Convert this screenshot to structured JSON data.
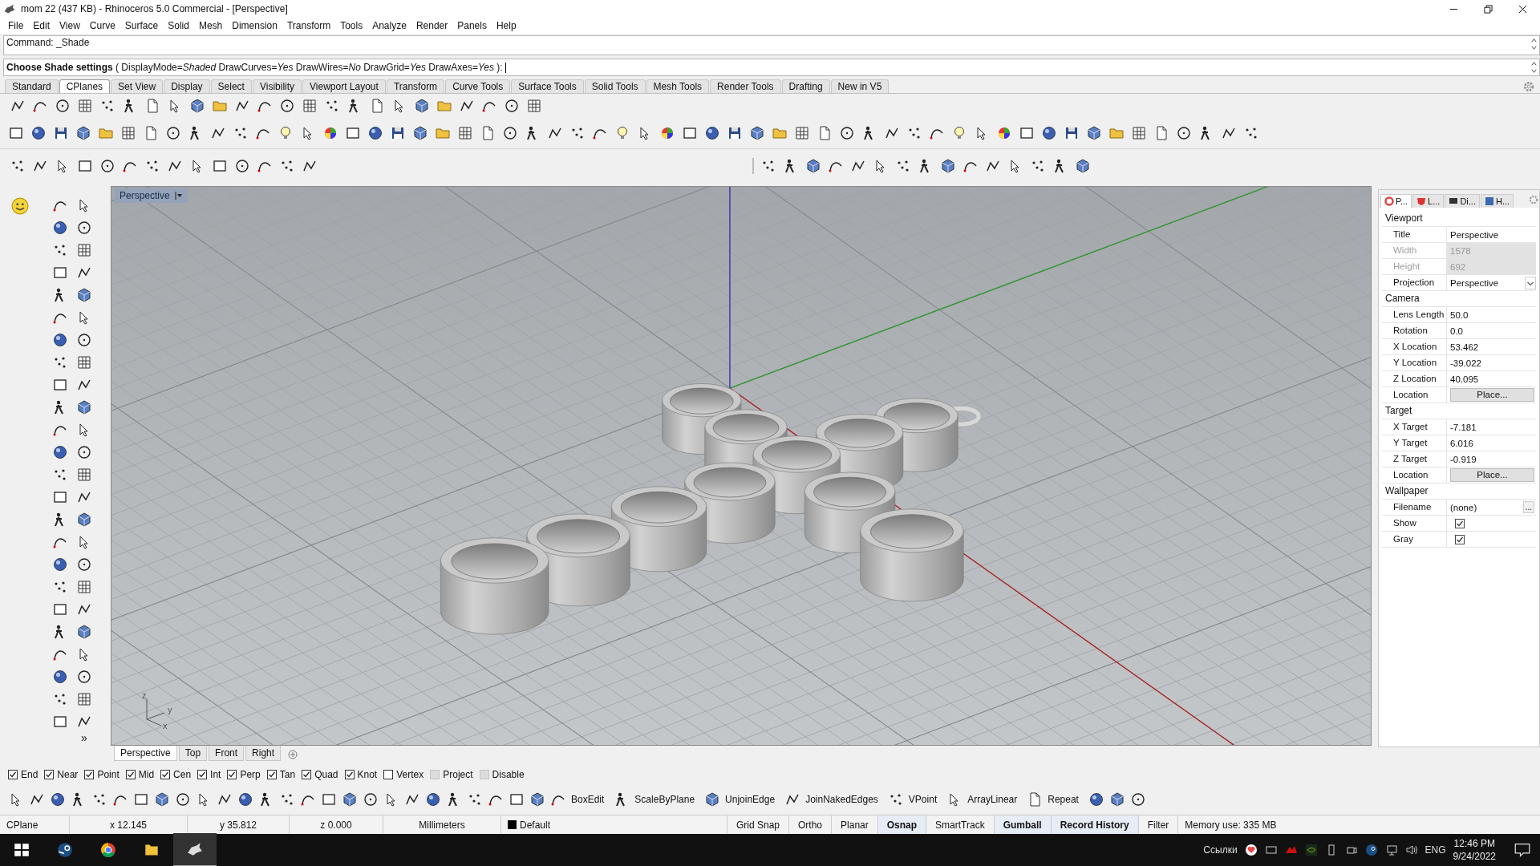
{
  "window": {
    "title": "mom 22 (437 KB) - Rhinoceros 5.0 Commercial - [Perspective]"
  },
  "menu": [
    "File",
    "Edit",
    "View",
    "Curve",
    "Surface",
    "Solid",
    "Mesh",
    "Dimension",
    "Transform",
    "Tools",
    "Analyze",
    "Render",
    "Panels",
    "Help"
  ],
  "command": {
    "history": "Command: _Shade",
    "prompt": "**Choose Shade settings** ( DisplayMode=*Shaded* DrawCurves=*Yes* DrawWires=*No* DrawGrid=*Yes* DrawAxes=*Yes* ):"
  },
  "toolbar_tabs": [
    {
      "label": "Standard",
      "selected": false
    },
    {
      "label": "CPlanes",
      "selected": true
    },
    {
      "label": "Set View",
      "selected": false
    },
    {
      "label": "Display",
      "selected": false
    },
    {
      "label": "Select",
      "selected": false
    },
    {
      "label": "Visibility",
      "selected": false
    },
    {
      "label": "Viewport Layout",
      "selected": false
    },
    {
      "label": "Transform",
      "selected": false
    },
    {
      "label": "Curve Tools",
      "selected": false
    },
    {
      "label": "Surface Tools",
      "selected": false
    },
    {
      "label": "Solid Tools",
      "selected": false
    },
    {
      "label": "Mesh Tools",
      "selected": false
    },
    {
      "label": "Render Tools",
      "selected": false
    },
    {
      "label": "Drafting",
      "selected": false
    },
    {
      "label": "New in V5",
      "selected": false
    }
  ],
  "left_toolbar_more": "»",
  "viewport": {
    "title": "Perspective",
    "axis_labels": [
      "z",
      "y",
      "x"
    ]
  },
  "viewport_tabs": [
    {
      "label": "Perspective",
      "selected": true
    },
    {
      "label": "Top",
      "selected": false
    },
    {
      "label": "Front",
      "selected": false
    },
    {
      "label": "Right",
      "selected": false
    }
  ],
  "panel": {
    "tabs": [
      {
        "label": "P...",
        "selected": true
      },
      {
        "label": "L...",
        "selected": false
      },
      {
        "label": "Di...",
        "selected": false
      },
      {
        "label": "H...",
        "selected": false
      }
    ],
    "sections": [
      {
        "title": "Viewport",
        "rows": [
          {
            "label": "Title",
            "value": "Perspective",
            "kind": "text"
          },
          {
            "label": "Width",
            "value": "1578",
            "kind": "readonly"
          },
          {
            "label": "Height",
            "value": "692",
            "kind": "readonly"
          },
          {
            "label": "Projection",
            "value": "Perspective",
            "kind": "dropdown"
          }
        ]
      },
      {
        "title": "Camera",
        "rows": [
          {
            "label": "Lens Length",
            "value": "50.0",
            "kind": "text"
          },
          {
            "label": "Rotation",
            "value": "0.0",
            "kind": "text"
          },
          {
            "label": "X Location",
            "value": "53.462",
            "kind": "text"
          },
          {
            "label": "Y Location",
            "value": "-39.022",
            "kind": "text"
          },
          {
            "label": "Z Location",
            "value": "40.095",
            "kind": "text"
          },
          {
            "label": "Location",
            "value": "Place...",
            "kind": "button"
          }
        ]
      },
      {
        "title": "Target",
        "rows": [
          {
            "label": "X Target",
            "value": "-7.181",
            "kind": "text"
          },
          {
            "label": "Y Target",
            "value": "6.016",
            "kind": "text"
          },
          {
            "label": "Z Target",
            "value": "-0.919",
            "kind": "text"
          },
          {
            "label": "Location",
            "value": "Place...",
            "kind": "button"
          }
        ]
      },
      {
        "title": "Wallpaper",
        "rows": [
          {
            "label": "Filename",
            "value": "(none)",
            "kind": "file",
            "button": "..."
          },
          {
            "label": "Show",
            "kind": "checkbox",
            "checked": true
          },
          {
            "label": "Gray",
            "kind": "checkbox",
            "checked": true
          }
        ]
      }
    ]
  },
  "osnaps": [
    {
      "label": "End",
      "checked": true,
      "disabled": false
    },
    {
      "label": "Near",
      "checked": true,
      "disabled": false
    },
    {
      "label": "Point",
      "checked": true,
      "disabled": false
    },
    {
      "label": "Mid",
      "checked": true,
      "disabled": false
    },
    {
      "label": "Cen",
      "checked": true,
      "disabled": false
    },
    {
      "label": "Int",
      "checked": true,
      "disabled": false
    },
    {
      "label": "Perp",
      "checked": true,
      "disabled": false
    },
    {
      "label": "Tan",
      "checked": true,
      "disabled": false
    },
    {
      "label": "Quad",
      "checked": true,
      "disabled": false
    },
    {
      "label": "Knot",
      "checked": true,
      "disabled": false
    },
    {
      "label": "Vertex",
      "checked": false,
      "disabled": false
    },
    {
      "label": "Project",
      "checked": false,
      "disabled": true
    },
    {
      "label": "Disable",
      "checked": false,
      "disabled": true
    }
  ],
  "command_buttons": [
    "BoxEdit",
    "ScaleByPlane",
    "UnjoinEdge",
    "JoinNakedEdges",
    "VPoint",
    "ArrayLinear",
    "Repeat"
  ],
  "status_bar": {
    "cplane": "CPlane",
    "x": "x 12.145",
    "y": "y 35.812",
    "z": "z 0.000",
    "units": "Millimeters",
    "layer": {
      "name": "Default",
      "color": "#000000"
    },
    "toggles": [
      {
        "label": "Grid Snap",
        "on": false
      },
      {
        "label": "Ortho",
        "on": false
      },
      {
        "label": "Planar",
        "on": false
      },
      {
        "label": "Osnap",
        "on": true
      },
      {
        "label": "SmartTrack",
        "on": false
      },
      {
        "label": "Gumball",
        "on": true
      },
      {
        "label": "Record History",
        "on": true
      },
      {
        "label": "Filter",
        "on": false
      }
    ],
    "memory": "Memory use: 335 MB"
  },
  "taskbar": {
    "toolbar_label": "Ссылки",
    "language": "ENG",
    "time": "12:46 PM",
    "date": "9/24/2022"
  }
}
